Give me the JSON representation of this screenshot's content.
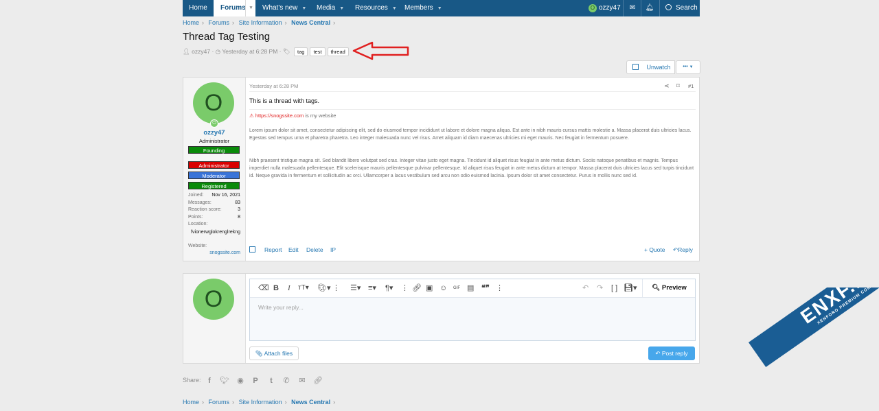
{
  "nav": {
    "home": "Home",
    "forums": "Forums",
    "whats_new": "What's new",
    "media": "Media",
    "resources": "Resources",
    "members": "Members",
    "user": "ozzy47",
    "user_initial": "O",
    "search": "Search"
  },
  "breadcrumb": [
    "Home",
    "Forums",
    "Site Information",
    "News Central"
  ],
  "thread": {
    "title": "Thread Tag Testing",
    "author": "ozzy47",
    "date": "Yesterday at 6:28 PM",
    "tags": [
      "tag",
      "test",
      "thread"
    ]
  },
  "buttons": {
    "unwatch": "Unwatch",
    "more": "•••"
  },
  "post": {
    "date": "Yesterday at 6:28 PM",
    "number": "#1",
    "text": "This is a thread with tags.",
    "sig_link": "https://snogssite.com",
    "sig_text": "is my website",
    "lorem1": "Lorem ipsum dolor sit amet, consectetur adipiscing elit, sed do eiusmod tempor incididunt ut labore et dolore magna aliqua. Est ante in nibh mauris cursus mattis molestie a. Massa placerat duis ultricies lacus. Egestas sed tempus urna et pharetra pharetra. Leo integer malesuada nunc vel risus. Amet aliquam id diam maecenas ultricies mi eget mauris. Nec feugiat in fermentum posuere.",
    "lorem2": "Nibh praesent tristique magna sit. Sed blandit libero volutpat sed cras. Integer vitae justo eget magna. Tincidunt id aliquet risus feugiat in ante metus dictum. Sociis natoque penatibus et magnis. Tempus imperdiet nulla malesuada pellentesque. Elit scelerisque mauris pellentesque pulvinar pellentesque. Id aliquet risus feugiat in ante metus dictum at tempor. Massa placerat duis ultricies lacus sed turpis tincidunt id. Neque gravida in fermentum et sollicitudin ac orci. Ullamcorper a lacus vestibulum sed arcu non odio euismod lacinia. Ipsum dolor sit amet consectetur. Purus in mollis nunc sed id.",
    "actions": {
      "report": "Report",
      "edit": "Edit",
      "delete": "Delete",
      "ip": "IP",
      "quote": "+ Quote",
      "reply": "Reply"
    }
  },
  "user": {
    "initial": "O",
    "name": "ozzy47",
    "title": "Administrator",
    "banners": [
      {
        "label": "Founding",
        "color": "#0a8a0a"
      },
      {
        "label": "Administrator",
        "color": "#d90000"
      },
      {
        "label": "Moderator",
        "color": "#3a74d8"
      },
      {
        "label": "Registered",
        "color": "#0a8a0a"
      }
    ],
    "stats": {
      "joined_label": "Joined:",
      "joined": "Nov 16, 2021",
      "messages_label": "Messages:",
      "messages": "83",
      "reaction_label": "Reaction score:",
      "reaction": "3",
      "points_label": "Points:",
      "points": "8",
      "location_label": "Location:",
      "location": "fvionerwglokrenglrekng",
      "website_label": "Website:",
      "website": "snogssite.com"
    }
  },
  "reply": {
    "placeholder": "Write your reply...",
    "preview": "Preview",
    "attach": "Attach files",
    "post_reply": "Post reply"
  },
  "share_label": "Share:",
  "watermark": {
    "main": "ENXF.NET",
    "sub": "XENFORO PREMIUM COMMUNITY"
  },
  "colors": {
    "nav_bg": "#185886",
    "link": "#2577b1",
    "avatar_bg": "#7acb6a",
    "primary_btn": "#47a7eb",
    "arrow": "#e02020"
  }
}
